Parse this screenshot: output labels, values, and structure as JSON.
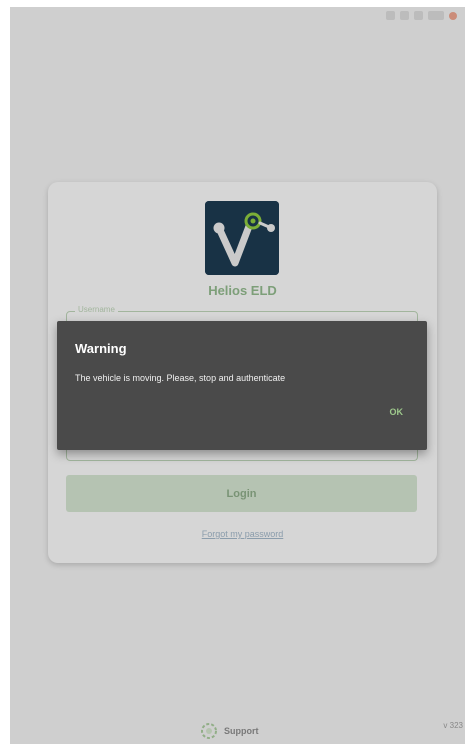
{
  "app": {
    "name": "Helios ELD"
  },
  "login_form": {
    "username_label": "Username",
    "login_button": "Login",
    "forgot_link": "Forgot my password"
  },
  "footer": {
    "support_label": "Support",
    "version": "v 323"
  },
  "dialog": {
    "title": "Warning",
    "message": "The vehicle is moving. Please, stop and authenticate",
    "ok_button": "OK"
  },
  "icons": {
    "logo": "helios-logo-icon",
    "support": "support-icon",
    "status": [
      "signal-icon",
      "wifi-icon",
      "alarm-icon",
      "battery-icon",
      "recording-icon"
    ]
  },
  "colors": {
    "accent_green": "#9ec98c",
    "logo_background": "#1c3a4f",
    "dialog_background": "#4a4a4a"
  }
}
